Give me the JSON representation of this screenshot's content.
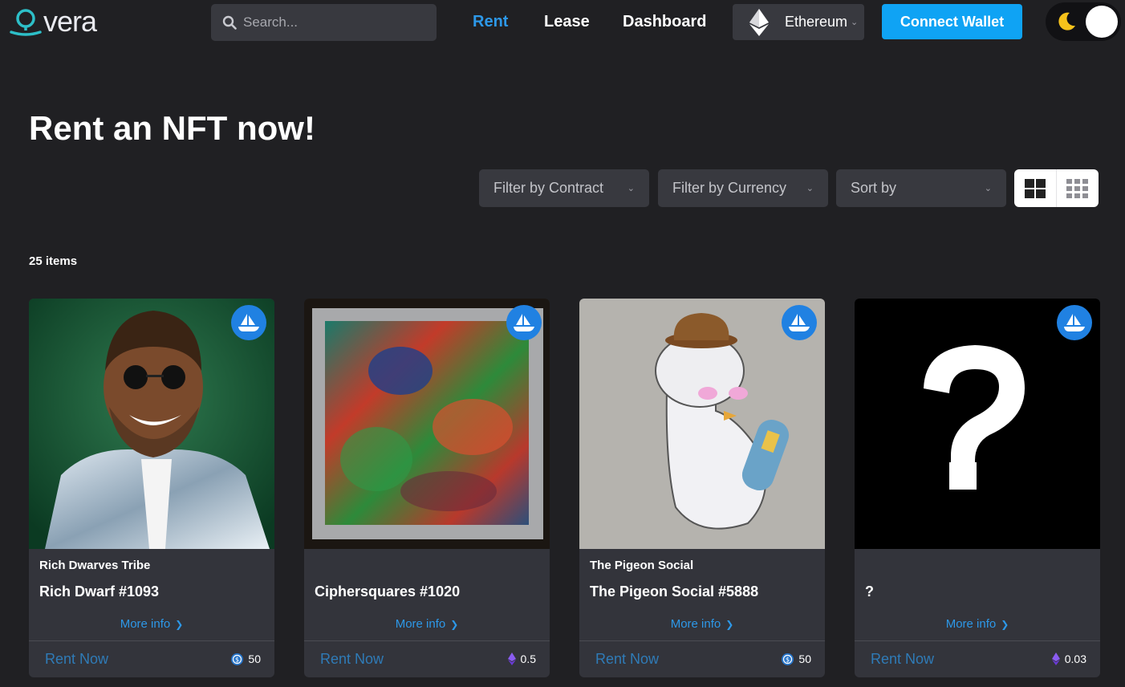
{
  "header": {
    "logo_text": "vera",
    "search_placeholder": "Search...",
    "nav": [
      {
        "label": "Rent",
        "active": true
      },
      {
        "label": "Lease",
        "active": false
      },
      {
        "label": "Dashboard",
        "active": false
      }
    ],
    "network": {
      "label": "Ethereum",
      "icon": "ethereum-icon"
    },
    "connect_label": "Connect Wallet",
    "theme_icon": "moon-icon"
  },
  "page_title": "Rent an NFT now!",
  "filters": {
    "contract_label": "Filter by Contract",
    "currency_label": "Filter by Currency",
    "sort_label": "Sort by"
  },
  "view_toggle": {
    "options": [
      "grid-large-icon",
      "grid-small-icon"
    ],
    "selected": "grid-large-icon"
  },
  "item_count": "25 items",
  "cards": [
    {
      "collection": "Rich Dwarves Tribe",
      "name": "Rich Dwarf #1093",
      "more_info": "More info",
      "rent_label": "Rent Now",
      "price": "50",
      "currency_icon": "usdc-icon"
    },
    {
      "collection": "",
      "name": "Ciphersquares #1020",
      "more_info": "More info",
      "rent_label": "Rent Now",
      "price": "0.5",
      "currency_icon": "weth-icon"
    },
    {
      "collection": "The Pigeon Social",
      "name": "The Pigeon Social #5888",
      "more_info": "More info",
      "rent_label": "Rent Now",
      "price": "50",
      "currency_icon": "usdc-icon"
    },
    {
      "collection": "",
      "name": "?",
      "more_info": "More info",
      "rent_label": "Rent Now",
      "price": "0.03",
      "currency_icon": "weth-icon"
    }
  ],
  "colors": {
    "background": "#202023",
    "card": "#33343b",
    "accent": "#2d98e8",
    "connect_button": "#0fa3f4",
    "opensea_badge": "#2081e2"
  }
}
